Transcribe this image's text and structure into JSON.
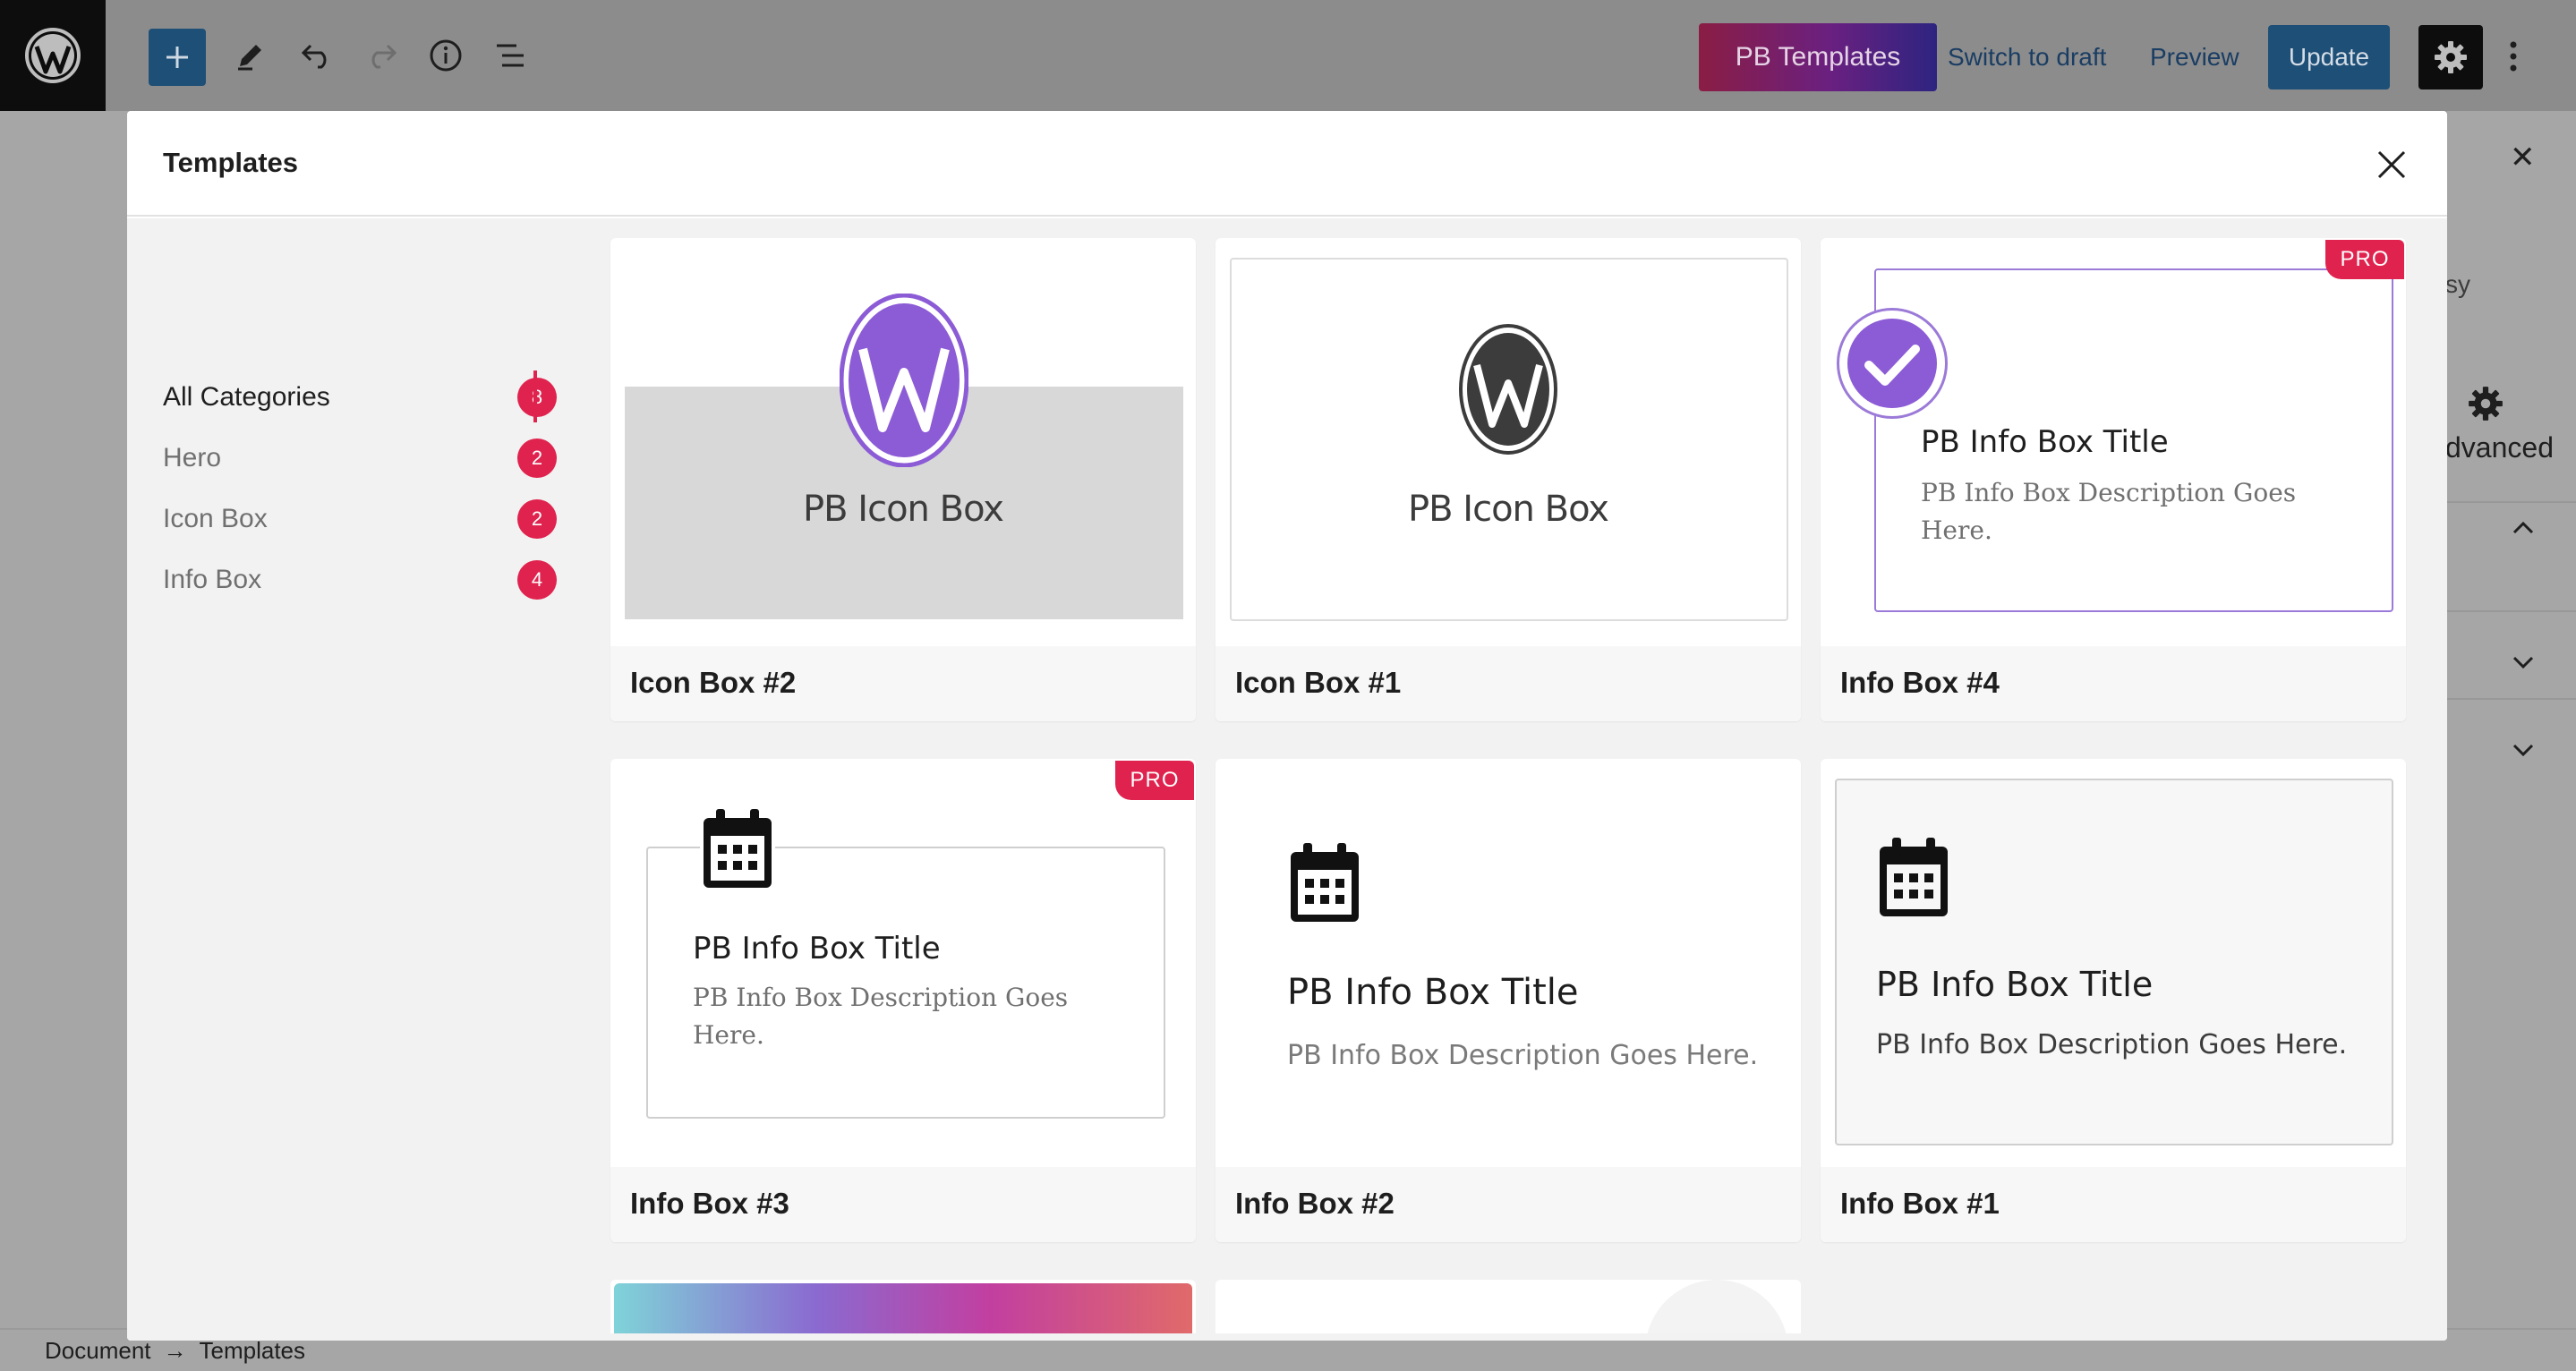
{
  "toolbar": {
    "pb_templates_label": "PB Templates",
    "switch_to_draft_label": "Switch to draft",
    "preview_label": "Preview",
    "update_label": "Update"
  },
  "background_sidebar": {
    "partial_text": "sy",
    "advanced_label": "dvanced"
  },
  "modal": {
    "title": "Templates",
    "categories": [
      {
        "label": "All Categories",
        "count": "8",
        "active": true
      },
      {
        "label": "Hero",
        "count": "2"
      },
      {
        "label": "Icon Box",
        "count": "2"
      },
      {
        "label": "Info Box",
        "count": "4"
      }
    ],
    "cards": [
      {
        "label": "Icon Box #2",
        "preview_title": "PB Icon Box",
        "pro": false
      },
      {
        "label": "Icon Box #1",
        "preview_title": "PB Icon Box",
        "pro": false
      },
      {
        "label": "Info Box #4",
        "preview_title": "PB Info Box Title",
        "preview_desc_line1": "PB Info Box Description Goes",
        "preview_desc_line2": "Here.",
        "pro": true,
        "pro_label": "PRO"
      },
      {
        "label": "Info Box #3",
        "preview_title": "PB Info Box Title",
        "preview_desc_line1": "PB Info Box Description Goes",
        "preview_desc_line2": "Here.",
        "pro": true,
        "pro_label": "PRO"
      },
      {
        "label": "Info Box #2",
        "preview_title": "PB Info Box Title",
        "preview_desc": "PB Info Box Description Goes Here.",
        "pro": false
      },
      {
        "label": "Info Box #1",
        "preview_title": "PB Info Box Title",
        "preview_desc": "PB Info Box Description Goes Here.",
        "pro": false
      }
    ]
  },
  "footer": {
    "breadcrumb": [
      "Document",
      "Templates"
    ],
    "separator": "→"
  },
  "colors": {
    "accent_pink": "#e0234e",
    "admin_blue": "#1e4f77",
    "wp_purple": "#8c5bd6"
  },
  "icons": [
    "wordpress-logo-icon",
    "plus-icon",
    "pencil-icon",
    "undo-icon",
    "redo-icon",
    "info-icon",
    "list-view-icon",
    "gear-icon",
    "more-vertical-icon",
    "close-icon",
    "calendar-icon",
    "check-circle-icon",
    "chevron-up-icon",
    "chevron-down-icon"
  ]
}
